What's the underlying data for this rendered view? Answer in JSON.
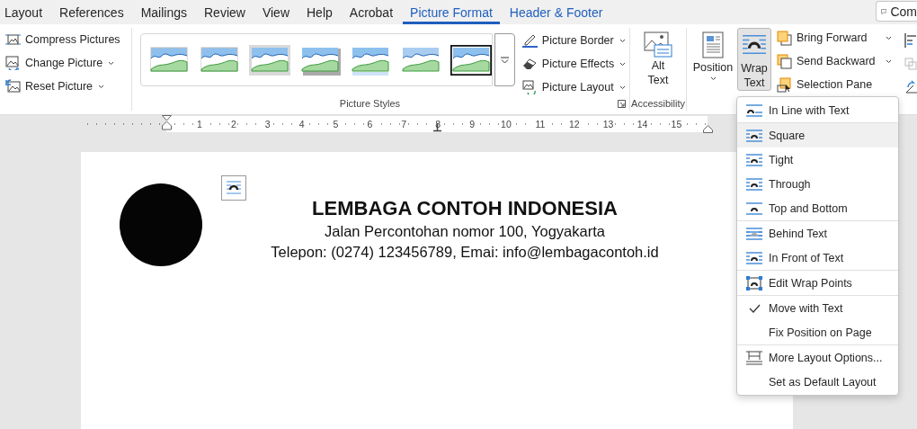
{
  "tabs": [
    {
      "label": "Layout",
      "selected": false,
      "contextual": false
    },
    {
      "label": "References",
      "selected": false,
      "contextual": false
    },
    {
      "label": "Mailings",
      "selected": false,
      "contextual": false
    },
    {
      "label": "Review",
      "selected": false,
      "contextual": false
    },
    {
      "label": "View",
      "selected": false,
      "contextual": false
    },
    {
      "label": "Help",
      "selected": false,
      "contextual": false
    },
    {
      "label": "Acrobat",
      "selected": false,
      "contextual": false
    },
    {
      "label": "Picture Format",
      "selected": true,
      "contextual": true
    },
    {
      "label": "Header & Footer",
      "selected": false,
      "contextual": true
    }
  ],
  "comments_button": {
    "label": "Com"
  },
  "adjust": [
    {
      "label": "Compress Pictures",
      "kind": "compress",
      "dropdown": false
    },
    {
      "label": "Change Picture",
      "kind": "change",
      "dropdown": true
    },
    {
      "label": "Reset Picture",
      "kind": "reset",
      "dropdown": true
    }
  ],
  "picture_styles": {
    "label": "Picture Styles",
    "commands": [
      {
        "label": "Picture Border",
        "kind": "border",
        "dropdown": true
      },
      {
        "label": "Picture Effects",
        "kind": "effects",
        "dropdown": true
      },
      {
        "label": "Picture Layout",
        "kind": "layout",
        "dropdown": true
      }
    ]
  },
  "accessibility": {
    "label": "Accessibility",
    "button": "Alt Text"
  },
  "position_button": {
    "label": "Position",
    "dropdown": true
  },
  "wrap_button": {
    "label": "Wrap Text",
    "pressed": true
  },
  "arrange": [
    {
      "label": "Bring Forward",
      "kind": "forward",
      "dropdown": true
    },
    {
      "label": "Send Backward",
      "kind": "backward",
      "dropdown": true
    },
    {
      "label": "Selection Pane",
      "kind": "pane",
      "dropdown": false
    }
  ],
  "ruler": {
    "labels": [
      "1",
      "2",
      "3",
      "4",
      "5",
      "6",
      "7",
      "8",
      "9",
      "10",
      "11",
      "12",
      "13",
      "14",
      "15"
    ]
  },
  "document": {
    "title": "LEMBAGA CONTOH INDONESIA",
    "address": "Jalan Percontohan nomor 100, Yogyakarta",
    "contact": "Telepon: (0274) 123456789, Emai: info@lembagacontoh.id"
  },
  "wrap_menu": {
    "sections": [
      [
        {
          "label": "In Line with Text",
          "kind": "inline",
          "selected": false
        }
      ],
      [
        {
          "label": "Square",
          "kind": "square",
          "selected": true
        },
        {
          "label": "Tight",
          "kind": "tight",
          "selected": false
        },
        {
          "label": "Through",
          "kind": "through",
          "selected": false
        },
        {
          "label": "Top and Bottom",
          "kind": "topbottom",
          "selected": false
        }
      ],
      [
        {
          "label": "Behind Text",
          "kind": "behind",
          "selected": false
        },
        {
          "label": "In Front of Text",
          "kind": "front",
          "selected": false
        }
      ],
      [
        {
          "label": "Edit Wrap Points",
          "kind": "points",
          "selected": false
        }
      ],
      [
        {
          "label": "Move with Text",
          "kind": "check",
          "selected": false,
          "checked": true
        },
        {
          "label": "Fix Position on Page",
          "kind": "check",
          "selected": false,
          "checked": false
        }
      ],
      [
        {
          "label": "More Layout Options...",
          "kind": "options",
          "selected": false
        },
        {
          "label": "Set as Default Layout",
          "kind": "plain",
          "selected": false
        }
      ]
    ]
  }
}
